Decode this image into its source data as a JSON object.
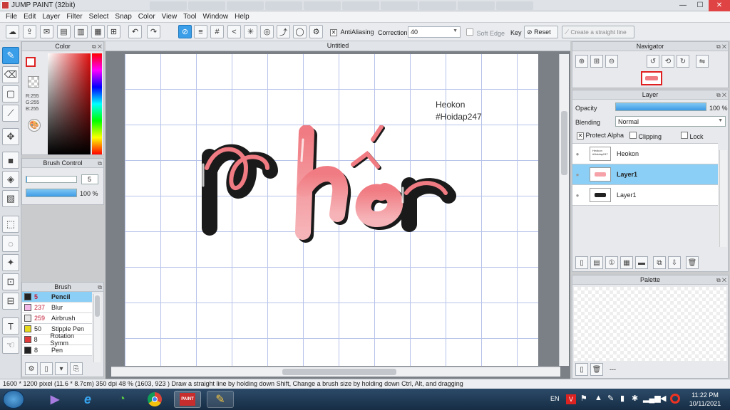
{
  "window": {
    "title": "JUMP PAINT (32bit)",
    "minimize": "—",
    "maximize": "☐",
    "close": "✕"
  },
  "menu": [
    "File",
    "Edit",
    "Layer",
    "Filter",
    "Select",
    "Snap",
    "Color",
    "View",
    "Tool",
    "Window",
    "Help"
  ],
  "toolbar": {
    "antialiasing_label": "AntiAliasing",
    "correction_label": "Correction",
    "correction_value": "40",
    "soft_edge_label": "Soft Edge",
    "key_label": "Key",
    "reset_label": "Reset",
    "straight_line_label": "Create a straight line"
  },
  "color_panel": {
    "title": "Color",
    "r": "R:255",
    "g": "G:255",
    "b": "B:255"
  },
  "brush_control": {
    "title": "Brush Control",
    "size": "5",
    "opacity": "100 %",
    "opacity_fraction": 1.0
  },
  "brush_panel": {
    "title": "Brush",
    "items": [
      {
        "num": "5",
        "name": "Pencil",
        "color": "#222222"
      },
      {
        "num": "237",
        "name": "Blur",
        "color": "#f4b8e8"
      },
      {
        "num": "259",
        "name": "Airbrush",
        "color": "#e6e6e6"
      },
      {
        "num": "50",
        "name": "Stipple Pen",
        "color": "#e7d91e"
      },
      {
        "num": "8",
        "name": "Rotation Symm",
        "color": "#e03a3a"
      },
      {
        "num": "8",
        "name": "Pen",
        "color": "#222222"
      }
    ],
    "selected_index": 0
  },
  "document": {
    "tab_title": "Untitled",
    "text_line1": "Heokon",
    "text_line2": "#Hoidap247",
    "artwork_color": "#f07b82"
  },
  "navigator": {
    "title": "Navigator"
  },
  "layer_panel": {
    "title": "Layer",
    "opacity_label": "Opacity",
    "opacity_value": "100 %",
    "opacity_fraction": 1.0,
    "blending_label": "Blending",
    "blending_value": "Normal",
    "protect_alpha_label": "Protect Alpha",
    "clipping_label": "Clipping",
    "lock_label": "Lock",
    "layers": [
      {
        "name": "Heokon",
        "selected": false
      },
      {
        "name": "Layer1",
        "selected": true
      },
      {
        "name": "Layer1",
        "selected": false
      }
    ]
  },
  "palette": {
    "title": "Palette",
    "footer": "---"
  },
  "status": "1600 * 1200 pixel  (11.6 * 8.7cm)  350 dpi  48 %  (1603, 923 )  Draw a straight line by holding down Shift, Change a brush size by holding down Ctrl, Alt, and dragging",
  "taskbar": {
    "lang": "EN",
    "time": "11:22 PM",
    "date": "10/11/2021"
  }
}
